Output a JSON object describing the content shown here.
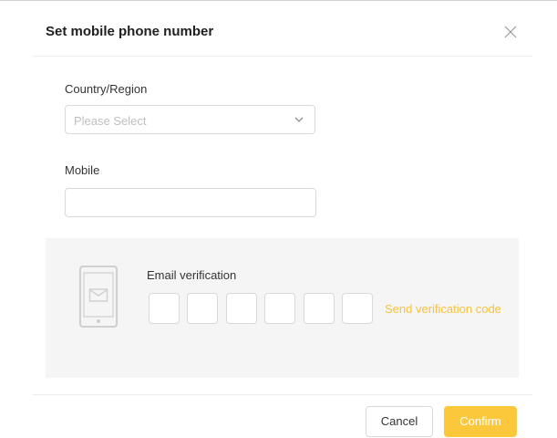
{
  "dialog": {
    "title": "Set mobile phone number",
    "close_icon": "close-icon"
  },
  "form": {
    "country_label": "Country/Region",
    "country_placeholder": "Please Select",
    "country_icon": "chevron-down-icon",
    "mobile_label": "Mobile",
    "mobile_value": ""
  },
  "verification": {
    "icon": "phone-mail-icon",
    "label": "Email verification",
    "code_digits": [
      "",
      "",
      "",
      "",
      "",
      ""
    ],
    "send_label": "Send verification code"
  },
  "footer": {
    "cancel_label": "Cancel",
    "confirm_label": "Confirm"
  },
  "colors": {
    "accent": "#FBC83C",
    "link": "#F8C23A",
    "panel_bg": "#F5F5F5",
    "border": "#D9D9D9",
    "placeholder": "#BFBFBF"
  }
}
